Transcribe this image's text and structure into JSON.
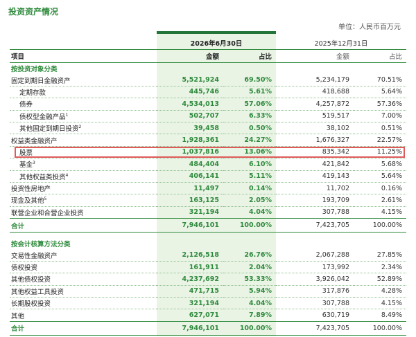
{
  "title": "投资资产情况",
  "unit": "单位：人民币百万元",
  "dates": {
    "current": "2026年6月30日",
    "previous": "2025年12月31日"
  },
  "headers": {
    "item": "项目",
    "amount": "金额",
    "ratio": "占比",
    "amount_prev": "金额",
    "ratio_prev": "占比"
  },
  "section1": {
    "label": "按投资对象分类",
    "rows": [
      {
        "label": "固定到期日金融资产",
        "sup": "",
        "amount": "5,521,924",
        "ratio": "69.50%",
        "amount_prev": "5,234,179",
        "ratio_prev": "70.51%"
      },
      {
        "label": "定期存款",
        "sup": "",
        "amount": "445,746",
        "ratio": "5.61%",
        "amount_prev": "418,688",
        "ratio_prev": "5.64%"
      },
      {
        "label": "债券",
        "sup": "",
        "amount": "4,534,013",
        "ratio": "57.06%",
        "amount_prev": "4,257,872",
        "ratio_prev": "57.36%"
      },
      {
        "label": "债权型金融产品",
        "sup": "1",
        "amount": "502,707",
        "ratio": "6.33%",
        "amount_prev": "519,517",
        "ratio_prev": "7.00%"
      },
      {
        "label": "其他固定到期日投资",
        "sup": "2",
        "amount": "39,458",
        "ratio": "0.50%",
        "amount_prev": "38,102",
        "ratio_prev": "0.51%"
      },
      {
        "label": "权益类金融资产",
        "sup": "",
        "amount": "1,928,361",
        "ratio": "24.27%",
        "amount_prev": "1,676,327",
        "ratio_prev": "22.57%"
      },
      {
        "label": "股票",
        "sup": "",
        "amount": "1,037,816",
        "ratio": "13.06%",
        "amount_prev": "835,342",
        "ratio_prev": "11.25%"
      },
      {
        "label": "基金",
        "sup": "3",
        "amount": "484,404",
        "ratio": "6.10%",
        "amount_prev": "421,842",
        "ratio_prev": "5.68%"
      },
      {
        "label": "其他权益类投资",
        "sup": "4",
        "amount": "406,141",
        "ratio": "5.11%",
        "amount_prev": "419,143",
        "ratio_prev": "5.64%"
      },
      {
        "label": "投资性房地产",
        "sup": "",
        "amount": "11,497",
        "ratio": "0.14%",
        "amount_prev": "11,702",
        "ratio_prev": "0.16%"
      },
      {
        "label": "现金及其他",
        "sup": "5",
        "amount": "163,125",
        "ratio": "2.05%",
        "amount_prev": "193,709",
        "ratio_prev": "2.61%"
      },
      {
        "label": "联营企业和合营企业投资",
        "sup": "",
        "amount": "321,194",
        "ratio": "4.04%",
        "amount_prev": "307,788",
        "ratio_prev": "4.15%"
      }
    ],
    "total": {
      "label": "合计",
      "amount": "7,946,101",
      "ratio": "100.00%",
      "amount_prev": "7,423,705",
      "ratio_prev": "100.00%"
    }
  },
  "section2": {
    "label": "按会计核算方法分类",
    "rows": [
      {
        "label": "交易性金融资产",
        "amount": "2,126,518",
        "ratio": "26.76%",
        "amount_prev": "2,067,288",
        "ratio_prev": "27.85%"
      },
      {
        "label": "债权投资",
        "amount": "161,911",
        "ratio": "2.04%",
        "amount_prev": "173,992",
        "ratio_prev": "2.34%"
      },
      {
        "label": "其他债权投资",
        "amount": "4,237,692",
        "ratio": "53.33%",
        "amount_prev": "3,926,042",
        "ratio_prev": "52.89%"
      },
      {
        "label": "其他权益工具投资",
        "amount": "471,715",
        "ratio": "5.94%",
        "amount_prev": "317,876",
        "ratio_prev": "4.28%"
      },
      {
        "label": "长期股权投资",
        "amount": "321,194",
        "ratio": "4.04%",
        "amount_prev": "307,788",
        "ratio_prev": "4.15%"
      },
      {
        "label": "其他",
        "amount": "627,071",
        "ratio": "7.89%",
        "amount_prev": "630,719",
        "ratio_prev": "8.49%"
      }
    ],
    "total": {
      "label": "合计",
      "amount": "7,946,101",
      "ratio": "100.00%",
      "amount_prev": "7,423,705",
      "ratio_prev": "100.00%"
    }
  },
  "colors": {
    "accent": "#2f8a3d",
    "column_bg": "#e9f4e5",
    "highlight": "#e15a5a"
  }
}
